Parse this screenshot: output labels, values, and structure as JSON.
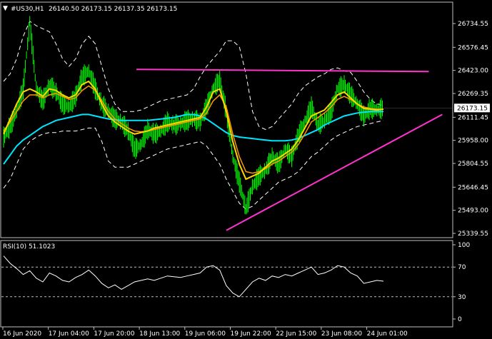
{
  "header": {
    "dropdown_glyph": "▼",
    "symbol": "#US30,H1",
    "ohlc": "26140.50 26173.15 26137.35 26173.15"
  },
  "colors": {
    "background": "#000000",
    "grid_border": "#c0c0c0",
    "candle_up": "#00ff00",
    "ma_fast": "#ffd700",
    "ma_mid": "#ff9900",
    "ma_slow": "#00e5ff",
    "bands": "#ffffff",
    "trendline": "#ff33cc",
    "price_tag_bg": "#ffffff",
    "price_tag_text": "#000000",
    "rsi_line": "#ffffff"
  },
  "price_axis": {
    "ticks": [
      "26734.55",
      "26576.45",
      "26423.00",
      "26269.35",
      "26111.45",
      "25958.00",
      "25804.55",
      "25646.45",
      "25493.00",
      "25339.55"
    ],
    "current_price": "26173.15"
  },
  "time_axis": {
    "labels": [
      "16 Jun 2020",
      "17 Jun 04:00",
      "17 Jun 20:00",
      "18 Jun 13:00",
      "19 Jun 06:00",
      "19 Jun 22:00",
      "22 Jun 15:00",
      "23 Jun 08:00",
      "24 Jun 01:00"
    ]
  },
  "rsi": {
    "title": "RSI(10) 51.1023",
    "ticks": [
      "100",
      "70",
      "30",
      "0"
    ]
  },
  "chart_data": {
    "type": "line",
    "price_ylim": [
      25339.55,
      26800
    ],
    "rsi_ylim": [
      0,
      100
    ],
    "rsi_levels": [
      70,
      30
    ],
    "price_close": [
      25980,
      26050,
      26150,
      26300,
      26750,
      26300,
      26220,
      26330,
      26280,
      26200,
      26180,
      26250,
      26380,
      26420,
      26300,
      26200,
      26150,
      26100,
      26080,
      26020,
      25900,
      25930,
      26030,
      26000,
      26020,
      26080,
      26060,
      26070,
      26090,
      26100,
      26080,
      26180,
      26300,
      26360,
      26150,
      25850,
      25680,
      25500,
      25650,
      25720,
      25760,
      25850,
      25800,
      25900,
      25850,
      25990,
      26080,
      26180,
      26060,
      26090,
      26150,
      26300,
      26330,
      26260,
      26200,
      26120,
      26170,
      26160,
      26173
    ],
    "ma_fast": [
      26000,
      26100,
      26200,
      26280,
      26300,
      26280,
      26250,
      26300,
      26290,
      26260,
      26240,
      26260,
      26330,
      26350,
      26300,
      26200,
      26120,
      26080,
      26050,
      26020,
      26000,
      26010,
      26020,
      26040,
      26050,
      26060,
      26070,
      26080,
      26090,
      26100,
      26110,
      26180,
      26280,
      26300,
      26150,
      25950,
      25800,
      25700,
      25720,
      25740,
      25780,
      25820,
      25840,
      25870,
      25900,
      25960,
      26040,
      26120,
      26140,
      26160,
      26210,
      26260,
      26280,
      26240,
      26200,
      26170,
      26165,
      26160,
      26165
    ],
    "ma_mid": [
      26020,
      26080,
      26150,
      26220,
      26260,
      26260,
      26240,
      26260,
      26270,
      26250,
      26230,
      26240,
      26290,
      26320,
      26290,
      26220,
      26150,
      26100,
      26070,
      26040,
      26020,
      26015,
      26020,
      26030,
      26040,
      26050,
      26060,
      26070,
      26080,
      26090,
      26100,
      26140,
      26220,
      26260,
      26180,
      26000,
      25850,
      25750,
      25740,
      25750,
      25770,
      25800,
      25820,
      25850,
      25880,
      25930,
      26000,
      26080,
      26110,
      26140,
      26180,
      26230,
      26250,
      26230,
      26200,
      26180,
      26170,
      26165,
      26165
    ],
    "ma_slow": [
      25800,
      25860,
      25920,
      25960,
      25990,
      26020,
      26050,
      26070,
      26090,
      26100,
      26110,
      26120,
      26130,
      26130,
      26120,
      26110,
      26100,
      26095,
      26090,
      26090,
      26090,
      26090,
      26090,
      26095,
      26100,
      26105,
      26110,
      26120,
      26130,
      26130,
      26120,
      26100,
      26070,
      26040,
      26010,
      25990,
      25980,
      25975,
      25970,
      25965,
      25960,
      25955,
      25955,
      25955,
      25960,
      25970,
      25990,
      26010,
      26030,
      26060,
      26080,
      26100,
      26120,
      26130,
      26140,
      26145,
      26150,
      26150,
      26150
    ],
    "band_upper": [
      26350,
      26400,
      26500,
      26650,
      26750,
      26720,
      26700,
      26680,
      26600,
      26500,
      26450,
      26500,
      26600,
      26650,
      26600,
      26450,
      26300,
      26200,
      26150,
      26150,
      26150,
      26160,
      26180,
      26200,
      26220,
      26230,
      26240,
      26250,
      26260,
      26300,
      26380,
      26450,
      26500,
      26550,
      26620,
      26620,
      26580,
      26400,
      26150,
      26050,
      26030,
      26050,
      26100,
      26150,
      26200,
      26270,
      26320,
      26350,
      26380,
      26400,
      26430,
      26440,
      26420,
      26410,
      26350,
      26280,
      26230,
      26200,
      26190
    ],
    "band_lower": [
      25640,
      25700,
      25800,
      25900,
      25950,
      25980,
      26000,
      26010,
      26010,
      26020,
      26020,
      26020,
      26030,
      26040,
      26040,
      25950,
      25820,
      25780,
      25780,
      25780,
      25800,
      25820,
      25840,
      25860,
      25880,
      25900,
      25910,
      25920,
      25930,
      25940,
      25950,
      25920,
      25860,
      25800,
      25700,
      25620,
      25540,
      25500,
      25520,
      25560,
      25600,
      25640,
      25680,
      25700,
      25720,
      25750,
      25800,
      25850,
      25880,
      25920,
      25960,
      25990,
      26010,
      26030,
      26050,
      26060,
      26070,
      26080,
      26090
    ],
    "trendline_upper": {
      "from": [
        0.3,
        26430
      ],
      "to": [
        0.95,
        26415
      ]
    },
    "trendline_lower": {
      "from": [
        0.5,
        25360
      ],
      "to": [
        0.98,
        26130
      ]
    },
    "rsi": [
      85,
      75,
      68,
      60,
      65,
      55,
      50,
      62,
      58,
      52,
      50,
      56,
      60,
      66,
      58,
      48,
      42,
      46,
      40,
      45,
      50,
      52,
      54,
      52,
      55,
      58,
      57,
      56,
      58,
      60,
      62,
      70,
      72,
      66,
      45,
      35,
      30,
      40,
      50,
      55,
      52,
      58,
      56,
      60,
      58,
      62,
      66,
      70,
      60,
      62,
      66,
      72,
      70,
      62,
      58,
      48,
      50,
      52,
      51
    ]
  }
}
